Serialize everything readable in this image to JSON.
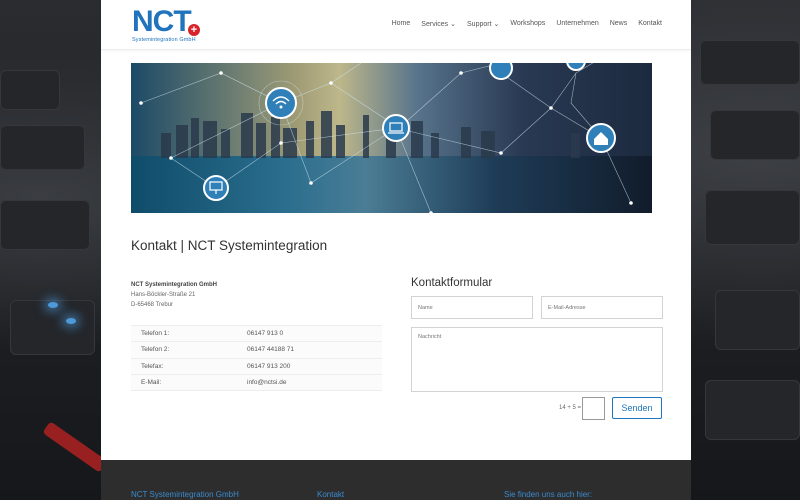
{
  "logo": {
    "mark": "NCT",
    "plus": "+",
    "subtitle": "Systemintegration GmbH"
  },
  "nav": {
    "items": [
      {
        "label": "Home",
        "has_dropdown": false,
        "active": false
      },
      {
        "label": "Services",
        "has_dropdown": true,
        "active": false
      },
      {
        "label": "Support",
        "has_dropdown": true,
        "active": false
      },
      {
        "label": "Workshops",
        "has_dropdown": false,
        "active": false
      },
      {
        "label": "Unternehmen",
        "has_dropdown": false,
        "active": false
      },
      {
        "label": "News",
        "has_dropdown": false,
        "active": false
      },
      {
        "label": "Kontakt",
        "has_dropdown": false,
        "active": true
      }
    ],
    "chevron": "⌄"
  },
  "page_title": "Kontakt | NCT Systemintegration",
  "address": {
    "company": "NCT Systemintegration GmbH",
    "street": "Hans-Böckler-Straße 21",
    "city": "D-65468 Trebur"
  },
  "contact_rows": [
    {
      "label": "Telefon 1:",
      "value": "06147 913 0"
    },
    {
      "label": "Telefon 2:",
      "value": "06147 44188 71"
    },
    {
      "label": "Telefax:",
      "value": "06147 913 200"
    },
    {
      "label": "E-Mail:",
      "value": "info@nctsi.de"
    }
  ],
  "form": {
    "title": "Kontaktformular",
    "name_placeholder": "Name",
    "email_placeholder": "E-Mail-Adresse",
    "message_placeholder": "Nachricht",
    "captcha_label": "14 + 5 =",
    "send_label": "Senden"
  },
  "footer": {
    "col1": "NCT Systemintegration GmbH",
    "col2": "Kontakt",
    "col3": "Sie finden uns auch hier:"
  },
  "colors": {
    "accent": "#1f74bd",
    "logo_red": "#d8232a",
    "footer_bg": "#2d2d2d"
  }
}
